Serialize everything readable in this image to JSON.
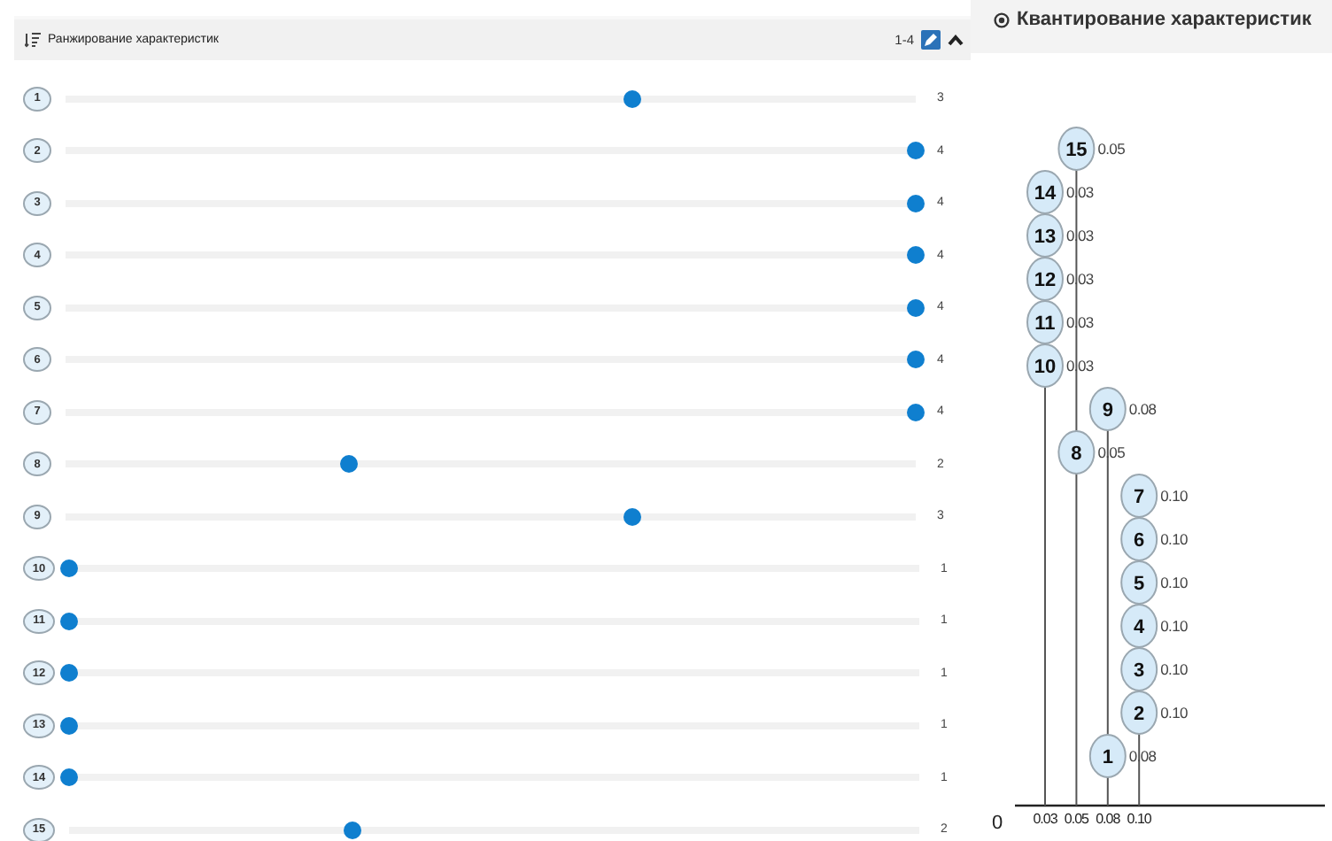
{
  "ranking": {
    "title": "Ранжирование характеристик",
    "range": "1-4",
    "rows": [
      {
        "number": "1",
        "level": 0.667,
        "value": "3"
      },
      {
        "number": "2",
        "level": 1,
        "value": "4"
      },
      {
        "number": "3",
        "level": 1,
        "value": "4"
      },
      {
        "number": "4",
        "level": 1,
        "value": "4"
      },
      {
        "number": "5",
        "level": 1,
        "value": "4"
      },
      {
        "number": "6",
        "level": 1,
        "value": "4"
      },
      {
        "number": "7",
        "level": 1,
        "value": "4"
      },
      {
        "number": "8",
        "level": 0.333,
        "value": "2"
      },
      {
        "number": "9",
        "level": 0.667,
        "value": "3"
      },
      {
        "number": "10",
        "level": 0,
        "value": "1"
      },
      {
        "number": "11",
        "level": 0,
        "value": "1"
      },
      {
        "number": "12",
        "level": 0,
        "value": "1"
      },
      {
        "number": "13",
        "level": 0,
        "value": "1"
      },
      {
        "number": "14",
        "level": 0,
        "value": "1"
      },
      {
        "number": "15",
        "level": 0.333,
        "value": "2"
      }
    ]
  },
  "quantization": {
    "title": "Квантирование характеристик",
    "zero_label": "0",
    "stems": [
      {
        "tick": "0.03",
        "nodes": [
          {
            "number": "14",
            "value": "0.03"
          },
          {
            "number": "13",
            "value": "0.03"
          },
          {
            "number": "12",
            "value": "0.03"
          },
          {
            "number": "11",
            "value": "0.03"
          },
          {
            "number": "10",
            "value": "0.03"
          }
        ]
      },
      {
        "tick": "0.05",
        "nodes": [
          {
            "number": "15",
            "value": "0.05"
          },
          {
            "number": "8",
            "value": "0.05"
          }
        ]
      },
      {
        "tick": "0.08",
        "nodes": [
          {
            "number": "9",
            "value": "0.08"
          },
          {
            "number": "1",
            "value": "0.08"
          }
        ]
      },
      {
        "tick": "0.10",
        "nodes": [
          {
            "number": "7",
            "value": "0.10"
          },
          {
            "number": "6",
            "value": "0.10"
          },
          {
            "number": "5",
            "value": "0.10"
          },
          {
            "number": "4",
            "value": "0.10"
          },
          {
            "number": "3",
            "value": "0.10"
          },
          {
            "number": "2",
            "value": "0.10"
          }
        ]
      }
    ]
  }
}
